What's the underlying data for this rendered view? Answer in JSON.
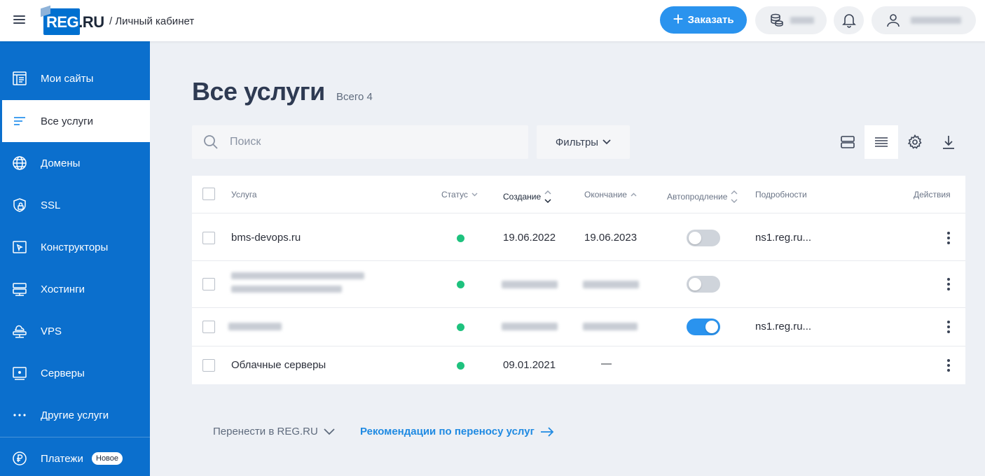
{
  "header": {
    "breadcrumb": "/ Личный кабинет",
    "order_label": "Заказать",
    "logo_text_main": "REG",
    "logo_text_ru": ".RU"
  },
  "sidebar": {
    "items": [
      {
        "label": "Мои сайты",
        "icon": "website-icon"
      },
      {
        "label": "Все услуги",
        "icon": "list-icon",
        "active": true
      },
      {
        "label": "Домены",
        "icon": "globe-icon"
      },
      {
        "label": "SSL",
        "icon": "shield-lock-icon"
      },
      {
        "label": "Конструкторы",
        "icon": "constructor-icon"
      },
      {
        "label": "Хостинги",
        "icon": "hosting-icon"
      },
      {
        "label": "VPS",
        "icon": "cloud-server-icon"
      },
      {
        "label": "Серверы",
        "icon": "server-icon"
      },
      {
        "label": "Другие услуги",
        "icon": "dots-icon"
      },
      {
        "label": "Платежи",
        "icon": "ruble-icon",
        "badge": "Новое"
      }
    ]
  },
  "main": {
    "title": "Все услуги",
    "total": "Всего 4",
    "search_placeholder": "Поиск",
    "filters_label": "Фильтры"
  },
  "table": {
    "columns": [
      "Услуга",
      "Статус",
      "Создание",
      "Окончание",
      "Автопродление",
      "Подробности",
      "Действия"
    ],
    "rows": [
      {
        "service": "bms-devops.ru",
        "status": "active",
        "created": "19.06.2022",
        "expires": "19.06.2023",
        "autorenew": false,
        "details": "ns1.reg.ru..."
      },
      {
        "service": "",
        "status": "active",
        "created": "",
        "expires": "",
        "autorenew": false,
        "details": ""
      },
      {
        "service": "",
        "status": "active",
        "created": "",
        "expires": "",
        "autorenew": true,
        "details": "ns1.reg.ru..."
      },
      {
        "service": "Облачные серверы",
        "status": "active",
        "created": "09.01.2021",
        "expires": "—",
        "autorenew": null,
        "details": ""
      }
    ]
  },
  "footer": {
    "transfer_label": "Перенести в REG.RU",
    "recommend_label": "Рекомендации по переносу услуг"
  },
  "colors": {
    "sidebar": "#0b6fcd",
    "accent": "#2a93ee",
    "status_active": "#1ec27e"
  }
}
